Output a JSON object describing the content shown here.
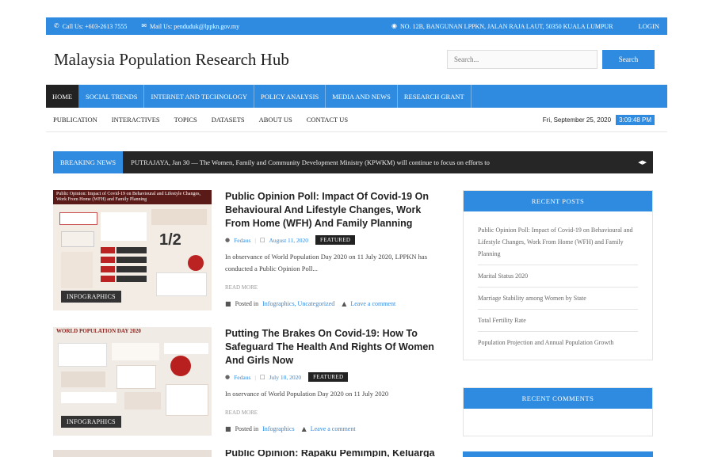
{
  "topbar": {
    "call": "Call Us: +603-2613 7555",
    "mail": "Mail Us: penduduk@lppkn.gov.my",
    "address": "NO. 12B, BANGUNAN LPPKN, JALAN RAJA LAUT, 50350 KUALA LUMPUR",
    "login": "LOGIN",
    "icons": [
      "phone-icon",
      "mail-icon",
      "map-marker-icon"
    ]
  },
  "header": {
    "title": "Malaysia Population Research Hub",
    "search_placeholder": "Search...",
    "search_button": "Search"
  },
  "main_nav": [
    {
      "label": "HOME",
      "active": true
    },
    {
      "label": "SOCIAL TRENDS"
    },
    {
      "label": "INTERNET AND TECHNOLOGY"
    },
    {
      "label": "POLICY ANALYSIS"
    },
    {
      "label": "MEDIA AND NEWS"
    },
    {
      "label": "RESEARCH GRANT"
    }
  ],
  "sub_nav": [
    "PUBLICATION",
    "INTERACTIVES",
    "TOPICS",
    "DATASETS",
    "ABOUT US",
    "CONTACT US"
  ],
  "datetime": {
    "date": "Fri, September 25, 2020",
    "time": "3:09:48 PM"
  },
  "breaking": {
    "label": "BREAKING NEWS",
    "text": "PUTRAJAYA, Jan 30 — The Women, Family and Community Development Ministry (KPWKM) will continue to focus on efforts to"
  },
  "posts": [
    {
      "title": "Public Opinion Poll: Impact Of Covid-19 On Behavioural And Lifestyle Changes, Work From Home (WFH) And Family Planning",
      "author": "Fedaus",
      "date": "August 11, 2020",
      "featured": "FEATURED",
      "excerpt": "In observance of World Population Day 2020 on 11 July 2020, LPPKN has conducted a Public Opinion Poll...",
      "read_more": "READ MORE",
      "posted_in": "Posted in",
      "categories": "Infographics, Uncategorized",
      "comment": "Leave a comment",
      "thumb_title": "Public Opinion: Impact of Covid-19 on Behavioural and Lifestyle Changes, Work From Home (WFH) and Family Planning",
      "thumb_badge": "INFOGRAPHICS"
    },
    {
      "title": "Putting The Brakes On Covid-19: How To Safeguard The Health And Rights Of Women And Girls Now",
      "author": "Fedaus",
      "date": "July 10, 2020",
      "featured": "FEATURED",
      "excerpt": "In oservance of World Population Day 2020 on 11 July 2020",
      "read_more": "READ MORE",
      "posted_in": "Posted in",
      "categories": "Infographics",
      "comment": "Leave a comment",
      "thumb_title": "WORLD POPULATION DAY 2020",
      "thumb_badge": "INFOGRAPHICS"
    },
    {
      "title": "Public Opinion: Rapaku Pemimpin, Keluarga"
    }
  ],
  "sidebar": {
    "recent_posts_title": "RECENT POSTS",
    "recent_posts": [
      "Public Opinion Poll: Impact of Covid-19 on Behavioural and Lifestyle Changes, Work From Home (WFH) and Family Planning",
      "Marital Status 2020",
      "Marriage Stability among Women by State",
      "Total Fertility Rate",
      "Population Projection and Annual Population Growth"
    ],
    "recent_comments_title": "RECENT COMMENTS"
  },
  "colors": {
    "accent": "#2f8be0",
    "dark": "#262626",
    "thumb_header": "#5a1a18"
  }
}
